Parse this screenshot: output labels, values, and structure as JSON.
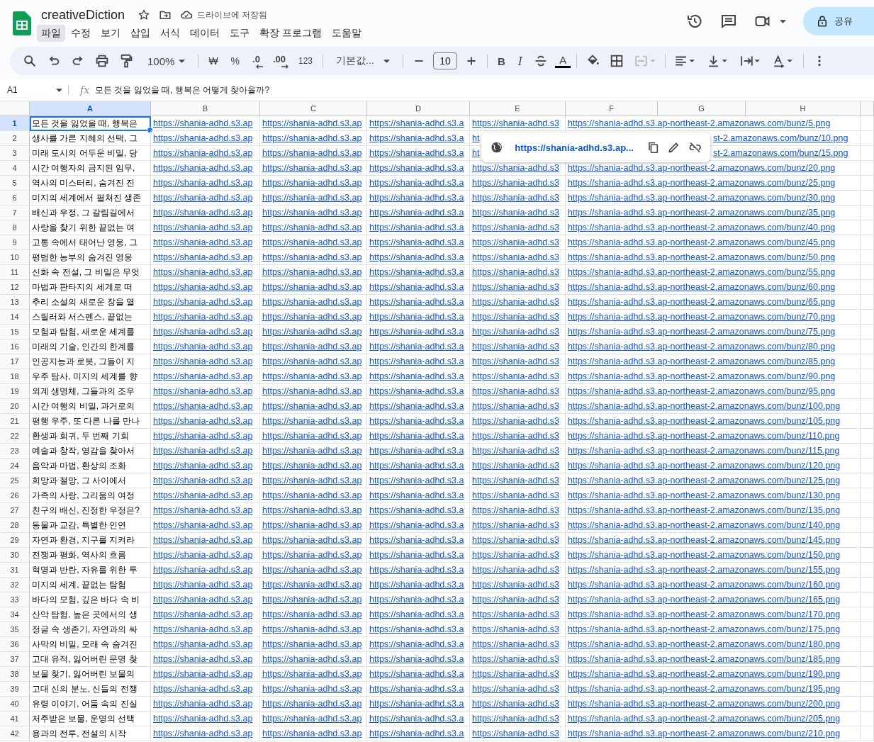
{
  "document": {
    "title": "creativeDiction",
    "save_status": "드라이브에 저장됨"
  },
  "menu": [
    {
      "label": "파일",
      "selected": true
    },
    {
      "label": "수정",
      "selected": false
    },
    {
      "label": "보기",
      "selected": false
    },
    {
      "label": "삽입",
      "selected": false
    },
    {
      "label": "서식",
      "selected": false
    },
    {
      "label": "데이터",
      "selected": false
    },
    {
      "label": "도구",
      "selected": false
    },
    {
      "label": "확장 프로그램",
      "selected": false
    },
    {
      "label": "도움말",
      "selected": false
    }
  ],
  "share_button": {
    "label": "공유"
  },
  "toolbar": {
    "zoom": "100%",
    "currency": "₩",
    "percent": "%",
    "decrease_decimals": ".0",
    "increase_decimals": ".00",
    "number_format": "123",
    "font": "기본값...",
    "font_size": "10",
    "bold": "B",
    "italic": "I",
    "text_color": "A"
  },
  "formula_bar": {
    "cell_ref": "A1",
    "fx": "fx",
    "formula": "모든 것을 잃었을 때, 행복은 어떻게 찾아올까?"
  },
  "columns": [
    {
      "label": "A",
      "selected": true
    },
    {
      "label": "B",
      "selected": false
    },
    {
      "label": "C",
      "selected": false
    },
    {
      "label": "D",
      "selected": false
    },
    {
      "label": "E",
      "selected": false
    },
    {
      "label": "F",
      "selected": false
    },
    {
      "label": "G",
      "selected": false
    },
    {
      "label": "H",
      "selected": false
    }
  ],
  "rows": [
    {
      "number": "1",
      "selected": true,
      "covered": false,
      "cells": [
        "모든 것을 잃었을 때, 행복은",
        "https://shania-adhd.s3.ap",
        "https://shania-adhd.s3.ap",
        "https://shania-adhd.s3.a",
        "https://shania-adhd.s3",
        "https://shania-adhd.s3.ap-northeast-2.amazonaws.com/bunz/5.png"
      ]
    },
    {
      "number": "2",
      "selected": false,
      "covered": true,
      "cells": [
        "생사를 가른 지혜의 선택, 그",
        "https://shania-adhd.s3.ap",
        "https://shania-adhd.s3.ap",
        "https://shania-adhd.s3.a",
        "ht",
        "st-2.amazonaws.com/bunz/10.png"
      ]
    },
    {
      "number": "3",
      "selected": false,
      "covered": true,
      "cells": [
        "미래 도시의 어두운 비밀, 당",
        "https://shania-adhd.s3.ap",
        "https://shania-adhd.s3.ap",
        "https://shania-adhd.s3.a",
        "ht",
        "st-2.amazonaws.com/bunz/15.png"
      ]
    },
    {
      "number": "4",
      "selected": false,
      "covered": false,
      "cells": [
        "시간 여행자의 금지된 임무,",
        "https://shania-adhd.s3.ap",
        "https://shania-adhd.s3.ap",
        "https://shania-adhd.s3.a",
        "https://shania-adhd.s3",
        "https://shania-adhd.s3.ap-northeast-2.amazonaws.com/bunz/20.png"
      ]
    },
    {
      "number": "5",
      "selected": false,
      "covered": false,
      "cells": [
        "역사의 미스터리, 숨겨진 진",
        "https://shania-adhd.s3.ap",
        "https://shania-adhd.s3.ap",
        "https://shania-adhd.s3.a",
        "https://shania-adhd.s3",
        "https://shania-adhd.s3.ap-northeast-2.amazonaws.com/bunz/25.png"
      ]
    },
    {
      "number": "6",
      "selected": false,
      "covered": false,
      "cells": [
        "미지의 세계에서 펼쳐진 생존",
        "https://shania-adhd.s3.ap",
        "https://shania-adhd.s3.ap",
        "https://shania-adhd.s3.a",
        "https://shania-adhd.s3",
        "https://shania-adhd.s3.ap-northeast-2.amazonaws.com/bunz/30.png"
      ]
    },
    {
      "number": "7",
      "selected": false,
      "covered": false,
      "cells": [
        "배신과 우정, 그 갈림길에서",
        "https://shania-adhd.s3.ap",
        "https://shania-adhd.s3.ap",
        "https://shania-adhd.s3.a",
        "https://shania-adhd.s3",
        "https://shania-adhd.s3.ap-northeast-2.amazonaws.com/bunz/35.png"
      ]
    },
    {
      "number": "8",
      "selected": false,
      "covered": false,
      "cells": [
        "사랑을 찾기 위한 끝없는 여",
        "https://shania-adhd.s3.ap",
        "https://shania-adhd.s3.ap",
        "https://shania-adhd.s3.a",
        "https://shania-adhd.s3",
        "https://shania-adhd.s3.ap-northeast-2.amazonaws.com/bunz/40.png"
      ]
    },
    {
      "number": "9",
      "selected": false,
      "covered": false,
      "cells": [
        "고통 속에서 태어난 영웅, 그",
        "https://shania-adhd.s3.ap",
        "https://shania-adhd.s3.ap",
        "https://shania-adhd.s3.a",
        "https://shania-adhd.s3",
        "https://shania-adhd.s3.ap-northeast-2.amazonaws.com/bunz/45.png"
      ]
    },
    {
      "number": "10",
      "selected": false,
      "covered": false,
      "cells": [
        "평범한 농부의 숨겨진 영웅",
        "https://shania-adhd.s3.ap",
        "https://shania-adhd.s3.ap",
        "https://shania-adhd.s3.a",
        "https://shania-adhd.s3",
        "https://shania-adhd.s3.ap-northeast-2.amazonaws.com/bunz/50.png"
      ]
    },
    {
      "number": "11",
      "selected": false,
      "covered": false,
      "cells": [
        "신화 속 전설, 그 비밀은 무엇",
        "https://shania-adhd.s3.ap",
        "https://shania-adhd.s3.ap",
        "https://shania-adhd.s3.a",
        "https://shania-adhd.s3",
        "https://shania-adhd.s3.ap-northeast-2.amazonaws.com/bunz/55.png"
      ]
    },
    {
      "number": "12",
      "selected": false,
      "covered": false,
      "cells": [
        "마법과 판타지의 세계로 떠",
        "https://shania-adhd.s3.ap",
        "https://shania-adhd.s3.ap",
        "https://shania-adhd.s3.a",
        "https://shania-adhd.s3",
        "https://shania-adhd.s3.ap-northeast-2.amazonaws.com/bunz/60.png"
      ]
    },
    {
      "number": "13",
      "selected": false,
      "covered": false,
      "cells": [
        "추리 소설의 새로운 장을 열",
        "https://shania-adhd.s3.ap",
        "https://shania-adhd.s3.ap",
        "https://shania-adhd.s3.a",
        "https://shania-adhd.s3",
        "https://shania-adhd.s3.ap-northeast-2.amazonaws.com/bunz/65.png"
      ]
    },
    {
      "number": "14",
      "selected": false,
      "covered": false,
      "cells": [
        "스릴러와 서스펜스, 끝없는",
        "https://shania-adhd.s3.ap",
        "https://shania-adhd.s3.ap",
        "https://shania-adhd.s3.a",
        "https://shania-adhd.s3",
        "https://shania-adhd.s3.ap-northeast-2.amazonaws.com/bunz/70.png"
      ]
    },
    {
      "number": "15",
      "selected": false,
      "covered": false,
      "cells": [
        "모험과 탐험, 새로운 세계를",
        "https://shania-adhd.s3.ap",
        "https://shania-adhd.s3.ap",
        "https://shania-adhd.s3.a",
        "https://shania-adhd.s3",
        "https://shania-adhd.s3.ap-northeast-2.amazonaws.com/bunz/75.png"
      ]
    },
    {
      "number": "16",
      "selected": false,
      "covered": false,
      "cells": [
        "미래의 기술, 인간의 한계를",
        "https://shania-adhd.s3.ap",
        "https://shania-adhd.s3.ap",
        "https://shania-adhd.s3.a",
        "https://shania-adhd.s3",
        "https://shania-adhd.s3.ap-northeast-2.amazonaws.com/bunz/80.png"
      ]
    },
    {
      "number": "17",
      "selected": false,
      "covered": false,
      "cells": [
        "인공지능과 로봇, 그들이 지",
        "https://shania-adhd.s3.ap",
        "https://shania-adhd.s3.ap",
        "https://shania-adhd.s3.a",
        "https://shania-adhd.s3",
        "https://shania-adhd.s3.ap-northeast-2.amazonaws.com/bunz/85.png"
      ]
    },
    {
      "number": "18",
      "selected": false,
      "covered": false,
      "cells": [
        "우주 탐사, 미지의 세계를 향",
        "https://shania-adhd.s3.ap",
        "https://shania-adhd.s3.ap",
        "https://shania-adhd.s3.a",
        "https://shania-adhd.s3",
        "https://shania-adhd.s3.ap-northeast-2.amazonaws.com/bunz/90.png"
      ]
    },
    {
      "number": "19",
      "selected": false,
      "covered": false,
      "cells": [
        "외계 생명체, 그들과의 조우",
        "https://shania-adhd.s3.ap",
        "https://shania-adhd.s3.ap",
        "https://shania-adhd.s3.a",
        "https://shania-adhd.s3",
        "https://shania-adhd.s3.ap-northeast-2.amazonaws.com/bunz/95.png"
      ]
    },
    {
      "number": "20",
      "selected": false,
      "covered": false,
      "cells": [
        "시간 여행의 비밀, 과거로의",
        "https://shania-adhd.s3.ap",
        "https://shania-adhd.s3.ap",
        "https://shania-adhd.s3.a",
        "https://shania-adhd.s3",
        "https://shania-adhd.s3.ap-northeast-2.amazonaws.com/bunz/100.png"
      ]
    },
    {
      "number": "21",
      "selected": false,
      "covered": false,
      "cells": [
        "평행 우주, 또 다른 나를 만나",
        "https://shania-adhd.s3.ap",
        "https://shania-adhd.s3.ap",
        "https://shania-adhd.s3.a",
        "https://shania-adhd.s3",
        "https://shania-adhd.s3.ap-northeast-2.amazonaws.com/bunz/105.png"
      ]
    },
    {
      "number": "22",
      "selected": false,
      "covered": false,
      "cells": [
        "환생과 회귀, 두 번째 기회",
        "https://shania-adhd.s3.ap",
        "https://shania-adhd.s3.ap",
        "https://shania-adhd.s3.a",
        "https://shania-adhd.s3",
        "https://shania-adhd.s3.ap-northeast-2.amazonaws.com/bunz/110.png"
      ]
    },
    {
      "number": "23",
      "selected": false,
      "covered": false,
      "cells": [
        "예술과 창작, 영감을 찾아서",
        "https://shania-adhd.s3.ap",
        "https://shania-adhd.s3.ap",
        "https://shania-adhd.s3.a",
        "https://shania-adhd.s3",
        "https://shania-adhd.s3.ap-northeast-2.amazonaws.com/bunz/115.png"
      ]
    },
    {
      "number": "24",
      "selected": false,
      "covered": false,
      "cells": [
        "음악과 마법, 환상의 조화",
        "https://shania-adhd.s3.ap",
        "https://shania-adhd.s3.ap",
        "https://shania-adhd.s3.a",
        "https://shania-adhd.s3",
        "https://shania-adhd.s3.ap-northeast-2.amazonaws.com/bunz/120.png"
      ]
    },
    {
      "number": "25",
      "selected": false,
      "covered": false,
      "cells": [
        "희망과 절망, 그 사이에서",
        "https://shania-adhd.s3.ap",
        "https://shania-adhd.s3.ap",
        "https://shania-adhd.s3.a",
        "https://shania-adhd.s3",
        "https://shania-adhd.s3.ap-northeast-2.amazonaws.com/bunz/125.png"
      ]
    },
    {
      "number": "26",
      "selected": false,
      "covered": false,
      "cells": [
        "가족의 사랑, 그리움의 여정",
        "https://shania-adhd.s3.ap",
        "https://shania-adhd.s3.ap",
        "https://shania-adhd.s3.a",
        "https://shania-adhd.s3",
        "https://shania-adhd.s3.ap-northeast-2.amazonaws.com/bunz/130.png"
      ]
    },
    {
      "number": "27",
      "selected": false,
      "covered": false,
      "cells": [
        "친구의 배신, 진정한 우정은?",
        "https://shania-adhd.s3.ap",
        "https://shania-adhd.s3.ap",
        "https://shania-adhd.s3.a",
        "https://shania-adhd.s3",
        "https://shania-adhd.s3.ap-northeast-2.amazonaws.com/bunz/135.png"
      ]
    },
    {
      "number": "28",
      "selected": false,
      "covered": false,
      "cells": [
        "동물과 교감, 특별한 인연",
        "https://shania-adhd.s3.ap",
        "https://shania-adhd.s3.ap",
        "https://shania-adhd.s3.a",
        "https://shania-adhd.s3",
        "https://shania-adhd.s3.ap-northeast-2.amazonaws.com/bunz/140.png"
      ]
    },
    {
      "number": "29",
      "selected": false,
      "covered": false,
      "cells": [
        "자연과 환경, 지구를 지켜라",
        "https://shania-adhd.s3.ap",
        "https://shania-adhd.s3.ap",
        "https://shania-adhd.s3.a",
        "https://shania-adhd.s3",
        "https://shania-adhd.s3.ap-northeast-2.amazonaws.com/bunz/145.png"
      ]
    },
    {
      "number": "30",
      "selected": false,
      "covered": false,
      "cells": [
        "전쟁과 평화, 역사의 흐름",
        "https://shania-adhd.s3.ap",
        "https://shania-adhd.s3.ap",
        "https://shania-adhd.s3.a",
        "https://shania-adhd.s3",
        "https://shania-adhd.s3.ap-northeast-2.amazonaws.com/bunz/150.png"
      ]
    },
    {
      "number": "31",
      "selected": false,
      "covered": false,
      "cells": [
        "혁명과 반란, 자유를 위한 투",
        "https://shania-adhd.s3.ap",
        "https://shania-adhd.s3.ap",
        "https://shania-adhd.s3.a",
        "https://shania-adhd.s3",
        "https://shania-adhd.s3.ap-northeast-2.amazonaws.com/bunz/155.png"
      ]
    },
    {
      "number": "32",
      "selected": false,
      "covered": false,
      "cells": [
        "미지의 세계, 끝없는 탐험",
        "https://shania-adhd.s3.ap",
        "https://shania-adhd.s3.ap",
        "https://shania-adhd.s3.a",
        "https://shania-adhd.s3",
        "https://shania-adhd.s3.ap-northeast-2.amazonaws.com/bunz/160.png"
      ]
    },
    {
      "number": "33",
      "selected": false,
      "covered": false,
      "cells": [
        "바다의 모험, 깊은 바다 속 비",
        "https://shania-adhd.s3.ap",
        "https://shania-adhd.s3.ap",
        "https://shania-adhd.s3.a",
        "https://shania-adhd.s3",
        "https://shania-adhd.s3.ap-northeast-2.amazonaws.com/bunz/165.png"
      ]
    },
    {
      "number": "34",
      "selected": false,
      "covered": false,
      "cells": [
        "산악 탐험, 높은 곳에서의 생",
        "https://shania-adhd.s3.ap",
        "https://shania-adhd.s3.ap",
        "https://shania-adhd.s3.a",
        "https://shania-adhd.s3",
        "https://shania-adhd.s3.ap-northeast-2.amazonaws.com/bunz/170.png"
      ]
    },
    {
      "number": "35",
      "selected": false,
      "covered": false,
      "cells": [
        "정글 속 생존기, 자연과의 싸",
        "https://shania-adhd.s3.ap",
        "https://shania-adhd.s3.ap",
        "https://shania-adhd.s3.a",
        "https://shania-adhd.s3",
        "https://shania-adhd.s3.ap-northeast-2.amazonaws.com/bunz/175.png"
      ]
    },
    {
      "number": "36",
      "selected": false,
      "covered": false,
      "cells": [
        "사막의 비밀, 모래 속 숨겨진",
        "https://shania-adhd.s3.ap",
        "https://shania-adhd.s3.ap",
        "https://shania-adhd.s3.a",
        "https://shania-adhd.s3",
        "https://shania-adhd.s3.ap-northeast-2.amazonaws.com/bunz/180.png"
      ]
    },
    {
      "number": "37",
      "selected": false,
      "covered": false,
      "cells": [
        "고대 유적, 잃어버린 문명 찾",
        "https://shania-adhd.s3.ap",
        "https://shania-adhd.s3.ap",
        "https://shania-adhd.s3.a",
        "https://shania-adhd.s3",
        "https://shania-adhd.s3.ap-northeast-2.amazonaws.com/bunz/185.png"
      ]
    },
    {
      "number": "38",
      "selected": false,
      "covered": false,
      "cells": [
        "보물 찾기, 잃어버린 보물의",
        "https://shania-adhd.s3.ap",
        "https://shania-adhd.s3.ap",
        "https://shania-adhd.s3.a",
        "https://shania-adhd.s3",
        "https://shania-adhd.s3.ap-northeast-2.amazonaws.com/bunz/190.png"
      ]
    },
    {
      "number": "39",
      "selected": false,
      "covered": false,
      "cells": [
        "고대 신의 분노, 신들의 전쟁",
        "https://shania-adhd.s3.ap",
        "https://shania-adhd.s3.ap",
        "https://shania-adhd.s3.a",
        "https://shania-adhd.s3",
        "https://shania-adhd.s3.ap-northeast-2.amazonaws.com/bunz/195.png"
      ]
    },
    {
      "number": "40",
      "selected": false,
      "covered": false,
      "cells": [
        "유령 이야기, 어둠 속의 진실",
        "https://shania-adhd.s3.ap",
        "https://shania-adhd.s3.ap",
        "https://shania-adhd.s3.a",
        "https://shania-adhd.s3",
        "https://shania-adhd.s3.ap-northeast-2.amazonaws.com/bunz/200.png"
      ]
    },
    {
      "number": "41",
      "selected": false,
      "covered": false,
      "cells": [
        "저주받은 보물, 운명의 선택",
        "https://shania-adhd.s3.ap",
        "https://shania-adhd.s3.ap",
        "https://shania-adhd.s3.a",
        "https://shania-adhd.s3",
        "https://shania-adhd.s3.ap-northeast-2.amazonaws.com/bunz/205.png"
      ]
    },
    {
      "number": "42",
      "selected": false,
      "covered": false,
      "cells": [
        "용과의 전투, 전설의 시작",
        "https://shania-adhd.s3.ap",
        "https://shania-adhd.s3.ap",
        "https://shania-adhd.s3.a",
        "https://shania-adhd.s3",
        "https://shania-adhd.s3.ap-northeast-2.amazonaws.com/bunz/210.png"
      ]
    }
  ],
  "link_popup": {
    "url": "https://shania-adhd.s3.ap..."
  }
}
